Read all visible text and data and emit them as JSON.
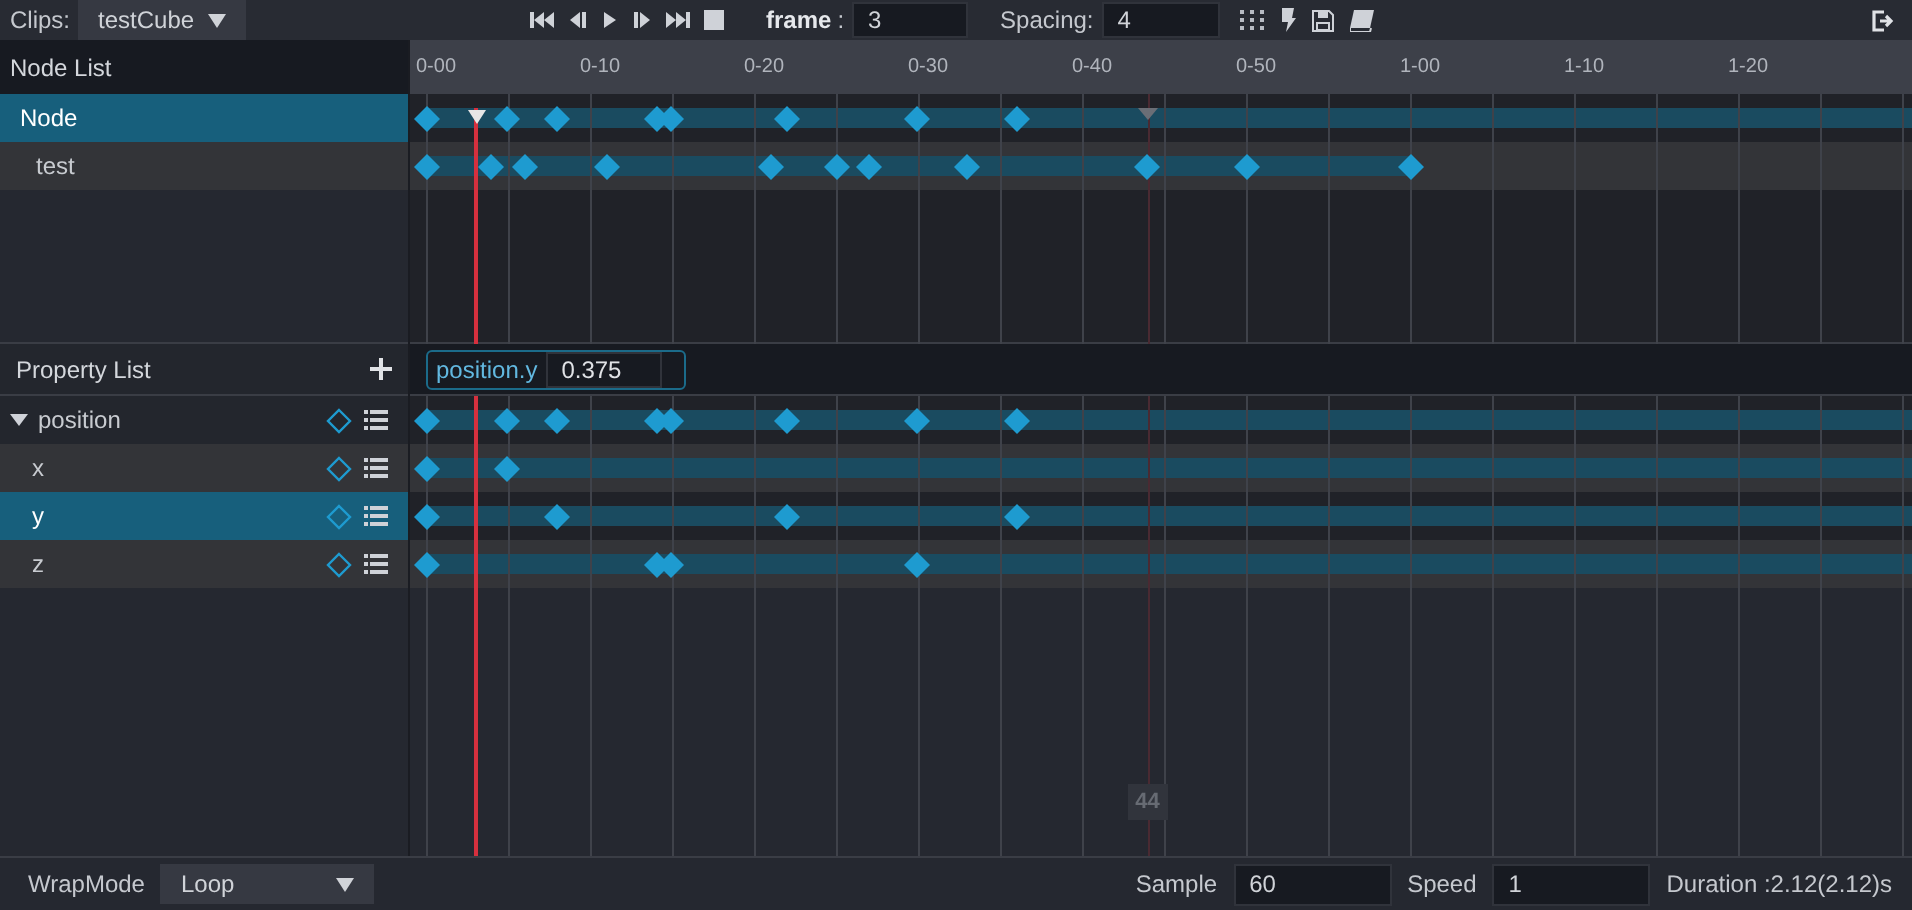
{
  "toolbar": {
    "clips_label": "Clips:",
    "clip": "testCube",
    "frame_label": "frame",
    "frame_colon": ":",
    "frame": "3",
    "spacing_label": "Spacing:",
    "spacing": "4"
  },
  "node_list": {
    "title": "Node List",
    "items": [
      {
        "name": "Node",
        "selected": true,
        "keyframes": [
          {
            "level": 0.011
          },
          {
            "level": 0.065
          },
          {
            "level": 0.098
          },
          {
            "level": 0.164
          },
          {
            "level": 0.174
          },
          {
            "level": 0.251
          },
          {
            "level": 0.338
          },
          {
            "level": 0.404
          }
        ]
      },
      {
        "name": "test",
        "selected": false,
        "keyframes": [
          {
            "level": 0.011
          },
          {
            "level": 0.054
          },
          {
            "level": 0.076
          },
          {
            "level": 0.131
          },
          {
            "level": 0.24
          },
          {
            "level": 0.284
          },
          {
            "level": 0.305
          },
          {
            "level": 0.371
          },
          {
            "level": 0.491
          },
          {
            "level": 0.557
          },
          {
            "level": 0.666
          }
        ]
      }
    ]
  },
  "ruler": {
    "ticks": [
      "0-00",
      "0-10",
      "0-20",
      "0-30",
      "0-40",
      "0-50",
      "1-00",
      "1-10",
      "1-20"
    ]
  },
  "property_list": {
    "title": "Property List",
    "editor": {
      "label": "position.y",
      "value": "0.375"
    },
    "items": [
      {
        "name": "position",
        "kind": "group",
        "expanded": true,
        "selected": false,
        "keyframes": [
          {
            "level": 0.011
          },
          {
            "level": 0.065
          },
          {
            "level": 0.098
          },
          {
            "level": 0.164
          },
          {
            "level": 0.174
          },
          {
            "level": 0.251
          },
          {
            "level": 0.338
          },
          {
            "level": 0.404
          }
        ]
      },
      {
        "name": "x",
        "kind": "channel",
        "selected": false,
        "keyframes": [
          {
            "level": 0.011
          },
          {
            "level": 0.065
          }
        ]
      },
      {
        "name": "y",
        "kind": "channel",
        "selected": true,
        "keyframes": [
          {
            "level": 0.011
          },
          {
            "level": 0.098
          },
          {
            "level": 0.251
          },
          {
            "level": 0.404
          }
        ]
      },
      {
        "name": "z",
        "kind": "channel",
        "selected": false,
        "keyframes": [
          {
            "level": 0.011
          },
          {
            "level": 0.164
          },
          {
            "level": 0.174
          },
          {
            "level": 0.338
          }
        ]
      }
    ]
  },
  "hover": {
    "label": "44"
  },
  "footer": {
    "wrap_label": "WrapMode",
    "wrap_mode": "Loop",
    "sample_label": "Sample",
    "sample": "60",
    "speed_label": "Speed",
    "speed": "1",
    "duration": "Duration :2.12(2.12)s"
  }
}
